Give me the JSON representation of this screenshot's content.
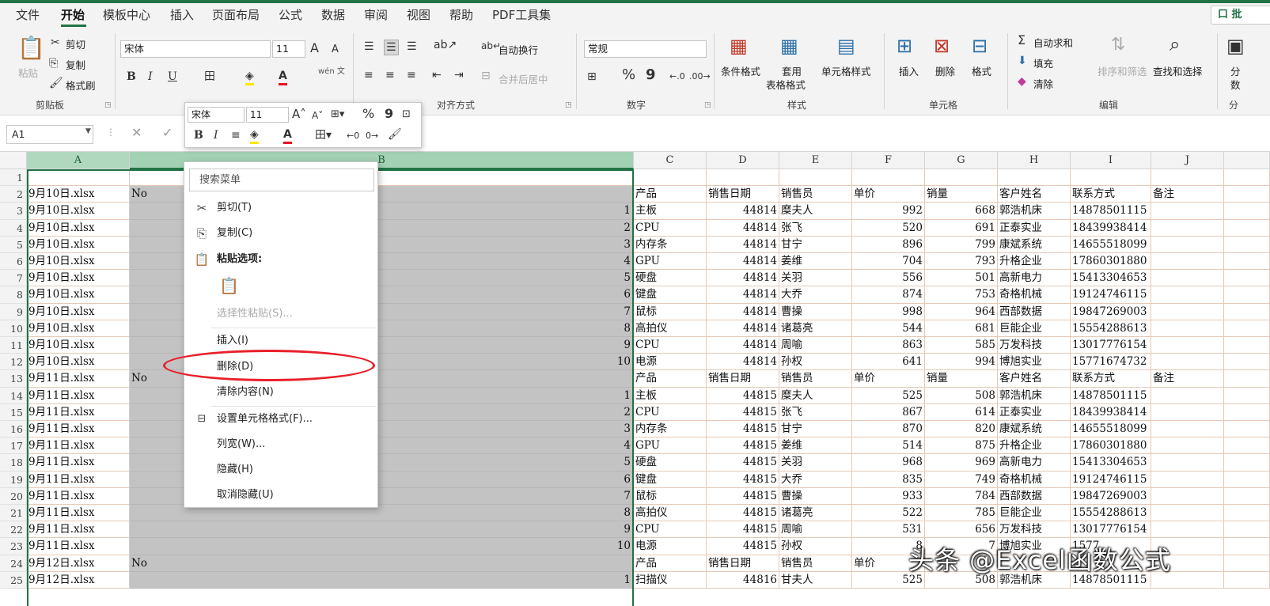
{
  "menu": {
    "tabs": [
      "文件",
      "开始",
      "模板中心",
      "插入",
      "页面布局",
      "公式",
      "数据",
      "审阅",
      "视图",
      "帮助",
      "PDF工具集"
    ],
    "share_label": "口 批"
  },
  "ribbon": {
    "clipboard": {
      "paste": "粘贴",
      "cut": "剪切",
      "copy": "复制",
      "format_painter": "格式刷",
      "group": "剪贴板"
    },
    "font": {
      "name": "宋体",
      "size": "11",
      "bold": "B",
      "italic": "I",
      "underline": "U",
      "grow": "A",
      "shrink": "A",
      "wen": "wén 文"
    },
    "alignment": {
      "wrap": "自动换行",
      "merge": "合并后居中",
      "group": "对齐方式"
    },
    "number": {
      "format": "常规",
      "percent": "%",
      "comma": "9",
      "group": "数字"
    },
    "styles": {
      "conditional": "条件格式",
      "table_line1": "套用",
      "table_line2": "表格格式",
      "cell_styles": "单元格样式",
      "group": "样式"
    },
    "cells": {
      "insert": "插入",
      "delete": "删除",
      "format": "格式",
      "group": "单元格"
    },
    "editing": {
      "autosum": "自动求和",
      "fill": "填充",
      "clear": "清除",
      "sort": "排序和筛选",
      "find": "查找和选择",
      "group": "编辑"
    },
    "analysis": {
      "label1": "分",
      "label2": "数",
      "group": "分"
    }
  },
  "namebox": "A1",
  "formula_icons": {
    "cancel": "✕",
    "enter": "✓"
  },
  "columns": [
    {
      "label": "A",
      "selected": true
    },
    {
      "label": "B",
      "selected": true
    },
    {
      "label": "C"
    },
    {
      "label": "D"
    },
    {
      "label": "E"
    },
    {
      "label": "F"
    },
    {
      "label": "G"
    },
    {
      "label": "H"
    },
    {
      "label": "I"
    },
    {
      "label": "J"
    }
  ],
  "rows": [
    {
      "n": "1",
      "a": "",
      "b": "",
      "bn": "",
      "c": "",
      "d": "",
      "e": "",
      "f": "",
      "g": "",
      "h": "",
      "i": "",
      "j": ""
    },
    {
      "n": "2",
      "a": "9月10日.xlsx",
      "b": "No",
      "bn": "",
      "c": "产品",
      "d": "销售日期",
      "e": "销售员",
      "f": "单价",
      "g": "销量",
      "h": "客户姓名",
      "i": "联系方式",
      "j": "备注",
      "hdr": true
    },
    {
      "n": "3",
      "a": "9月10日.xlsx",
      "b": "",
      "bn": "1",
      "c": "主板",
      "d": "44814",
      "e": "糜夫人",
      "f": "992",
      "g": "668",
      "h": "郭浩机床",
      "i": "14878501115",
      "j": ""
    },
    {
      "n": "4",
      "a": "9月10日.xlsx",
      "b": "",
      "bn": "2",
      "c": "CPU",
      "d": "44814",
      "e": "张飞",
      "f": "520",
      "g": "691",
      "h": "正泰实业",
      "i": "18439938414",
      "j": ""
    },
    {
      "n": "5",
      "a": "9月10日.xlsx",
      "b": "",
      "bn": "3",
      "c": "内存条",
      "d": "44814",
      "e": "甘宁",
      "f": "896",
      "g": "799",
      "h": "康斌系统",
      "i": "14655518099",
      "j": ""
    },
    {
      "n": "6",
      "a": "9月10日.xlsx",
      "b": "",
      "bn": "4",
      "c": "GPU",
      "d": "44814",
      "e": "姜维",
      "f": "704",
      "g": "793",
      "h": "升格企业",
      "i": "17860301880",
      "j": ""
    },
    {
      "n": "7",
      "a": "9月10日.xlsx",
      "b": "",
      "bn": "5",
      "c": "硬盘",
      "d": "44814",
      "e": "关羽",
      "f": "556",
      "g": "501",
      "h": "高新电力",
      "i": "15413304653",
      "j": ""
    },
    {
      "n": "8",
      "a": "9月10日.xlsx",
      "b": "",
      "bn": "6",
      "c": "键盘",
      "d": "44814",
      "e": "大乔",
      "f": "874",
      "g": "753",
      "h": "奇格机械",
      "i": "19124746115",
      "j": ""
    },
    {
      "n": "9",
      "a": "9月10日.xlsx",
      "b": "",
      "bn": "7",
      "c": "鼠标",
      "d": "44814",
      "e": "曹操",
      "f": "998",
      "g": "964",
      "h": "西部数据",
      "i": "19847269003",
      "j": ""
    },
    {
      "n": "10",
      "a": "9月10日.xlsx",
      "b": "",
      "bn": "8",
      "c": "高拍仪",
      "d": "44814",
      "e": "诸葛亮",
      "f": "544",
      "g": "681",
      "h": "巨能企业",
      "i": "15554288613",
      "j": ""
    },
    {
      "n": "11",
      "a": "9月10日.xlsx",
      "b": "",
      "bn": "9",
      "c": "CPU",
      "d": "44814",
      "e": "周喻",
      "f": "863",
      "g": "585",
      "h": "万发科技",
      "i": "13017776154",
      "j": ""
    },
    {
      "n": "12",
      "a": "9月10日.xlsx",
      "b": "",
      "bn": "10",
      "c": "电源",
      "d": "44814",
      "e": "孙权",
      "f": "641",
      "g": "994",
      "h": "博旭实业",
      "i": "15771674732",
      "j": ""
    },
    {
      "n": "13",
      "a": "9月11日.xlsx",
      "b": "No",
      "bn": "",
      "c": "产品",
      "d": "销售日期",
      "e": "销售员",
      "f": "单价",
      "g": "销量",
      "h": "客户姓名",
      "i": "联系方式",
      "j": "备注",
      "hdr": true
    },
    {
      "n": "14",
      "a": "9月11日.xlsx",
      "b": "",
      "bn": "1",
      "c": "主板",
      "d": "44815",
      "e": "糜夫人",
      "f": "525",
      "g": "508",
      "h": "郭浩机床",
      "i": "14878501115",
      "j": ""
    },
    {
      "n": "15",
      "a": "9月11日.xlsx",
      "b": "",
      "bn": "2",
      "c": "CPU",
      "d": "44815",
      "e": "张飞",
      "f": "867",
      "g": "614",
      "h": "正泰实业",
      "i": "18439938414",
      "j": ""
    },
    {
      "n": "16",
      "a": "9月11日.xlsx",
      "b": "",
      "bn": "3",
      "c": "内存条",
      "d": "44815",
      "e": "甘宁",
      "f": "870",
      "g": "820",
      "h": "康斌系统",
      "i": "14655518099",
      "j": ""
    },
    {
      "n": "17",
      "a": "9月11日.xlsx",
      "b": "",
      "bn": "4",
      "c": "GPU",
      "d": "44815",
      "e": "姜维",
      "f": "514",
      "g": "875",
      "h": "升格企业",
      "i": "17860301880",
      "j": ""
    },
    {
      "n": "18",
      "a": "9月11日.xlsx",
      "b": "",
      "bn": "5",
      "c": "硬盘",
      "d": "44815",
      "e": "关羽",
      "f": "968",
      "g": "969",
      "h": "高新电力",
      "i": "15413304653",
      "j": ""
    },
    {
      "n": "19",
      "a": "9月11日.xlsx",
      "b": "",
      "bn": "6",
      "c": "键盘",
      "d": "44815",
      "e": "大乔",
      "f": "835",
      "g": "749",
      "h": "奇格机械",
      "i": "19124746115",
      "j": ""
    },
    {
      "n": "20",
      "a": "9月11日.xlsx",
      "b": "",
      "bn": "7",
      "c": "鼠标",
      "d": "44815",
      "e": "曹操",
      "f": "933",
      "g": "784",
      "h": "西部数据",
      "i": "19847269003",
      "j": ""
    },
    {
      "n": "21",
      "a": "9月11日.xlsx",
      "b": "",
      "bn": "8",
      "c": "高拍仪",
      "d": "44815",
      "e": "诸葛亮",
      "f": "522",
      "g": "785",
      "h": "巨能企业",
      "i": "15554288613",
      "j": ""
    },
    {
      "n": "22",
      "a": "9月11日.xlsx",
      "b": "",
      "bn": "9",
      "c": "CPU",
      "d": "44815",
      "e": "周喻",
      "f": "531",
      "g": "656",
      "h": "万发科技",
      "i": "13017776154",
      "j": ""
    },
    {
      "n": "23",
      "a": "9月11日.xlsx",
      "b": "",
      "bn": "10",
      "c": "电源",
      "d": "44815",
      "e": "孙权",
      "f": "8",
      "g": "7",
      "h": "博旭实业",
      "i": "1577",
      "j": ""
    },
    {
      "n": "24",
      "a": "9月12日.xlsx",
      "b": "No",
      "bn": "",
      "c": "产品",
      "d": "销售日期",
      "e": "销售员",
      "f": "单价",
      "g": "",
      "h": "",
      "i": "",
      "j": "",
      "hdr": true
    },
    {
      "n": "25",
      "a": "9月12日.xlsx",
      "b": "",
      "bn": "1",
      "c": "扫描仪",
      "d": "44816",
      "e": "甘夫人",
      "f": "525",
      "g": "508",
      "h": "郭浩机床",
      "i": "14878501115",
      "j": ""
    }
  ],
  "mini_toolbar": {
    "font": "宋体",
    "size": "11"
  },
  "context_menu": {
    "search_placeholder": "搜索菜单",
    "cut": "剪切(T)",
    "copy": "复制(C)",
    "paste_options": "粘贴选项:",
    "paste_special": "选择性粘贴(S)...",
    "insert": "插入(I)",
    "delete": "删除(D)",
    "clear": "清除内容(N)",
    "format_cells": "设置单元格格式(F)...",
    "col_width": "列宽(W)...",
    "hide": "隐藏(H)",
    "unhide": "取消隐藏(U)"
  },
  "watermark": "头条 @Excel函数公式"
}
